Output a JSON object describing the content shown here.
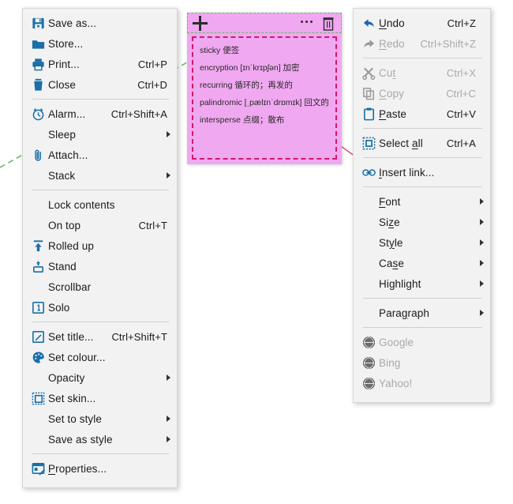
{
  "app": {
    "title": "Sticky note with context menus",
    "note_color": "#f0a8f0",
    "accent_icon_color": "#1a6fa8",
    "disabled_color": "#a9a9a9",
    "green_guide_color": "#66bb66",
    "red_guide_color": "#c0395f"
  },
  "left_menu": {
    "name": "note-context-menu",
    "groups": [
      {
        "items": [
          {
            "icon": "floppy-disk-icon",
            "label": "Save as...",
            "accel": "",
            "arrow": false,
            "disabled": false
          },
          {
            "icon": "folder-icon",
            "label": "Store...",
            "accel": "",
            "arrow": false,
            "disabled": false
          },
          {
            "icon": "printer-icon",
            "label": "Print...",
            "accel": "Ctrl+P",
            "arrow": false,
            "disabled": false
          },
          {
            "icon": "trash-icon",
            "label": "Close",
            "accel": "Ctrl+D",
            "arrow": false,
            "disabled": false
          }
        ]
      },
      {
        "items": [
          {
            "icon": "alarm-clock-icon",
            "label": "Alarm...",
            "accel": "Ctrl+Shift+A",
            "arrow": false,
            "disabled": false
          },
          {
            "icon": "",
            "label": "Sleep",
            "accel": "",
            "arrow": true,
            "disabled": false
          },
          {
            "icon": "paperclip-icon",
            "label": "Attach...",
            "accel": "",
            "arrow": false,
            "disabled": false
          },
          {
            "icon": "",
            "label": "Stack",
            "accel": "",
            "arrow": true,
            "disabled": false
          }
        ]
      },
      {
        "items": [
          {
            "icon": "",
            "label": "Lock contents",
            "accel": "",
            "arrow": false,
            "disabled": false
          },
          {
            "icon": "",
            "label": "On top",
            "accel": "Ctrl+T",
            "arrow": false,
            "disabled": false
          },
          {
            "icon": "roll-up-icon",
            "label": "Rolled up",
            "accel": "",
            "arrow": false,
            "disabled": false
          },
          {
            "icon": "stand-icon",
            "label": "Stand",
            "accel": "",
            "arrow": false,
            "disabled": false
          },
          {
            "icon": "",
            "label": "Scrollbar",
            "accel": "",
            "arrow": false,
            "disabled": false
          },
          {
            "icon": "solo-icon",
            "label": "Solo",
            "accel": "",
            "arrow": false,
            "disabled": false
          }
        ]
      },
      {
        "items": [
          {
            "icon": "pencil-square-icon",
            "label": "Set title...",
            "accel": "Ctrl+Shift+T",
            "arrow": false,
            "disabled": false
          },
          {
            "icon": "palette-icon",
            "label": "Set colour...",
            "accel": "",
            "arrow": false,
            "disabled": false
          },
          {
            "icon": "",
            "label": "Opacity",
            "accel": "",
            "arrow": true,
            "disabled": false
          },
          {
            "icon": "skin-icon",
            "label": "Set skin...",
            "accel": "",
            "arrow": false,
            "disabled": false
          },
          {
            "icon": "",
            "label": "Set to style",
            "accel": "",
            "arrow": true,
            "disabled": false
          },
          {
            "icon": "",
            "label": "Save as style",
            "accel": "",
            "arrow": true,
            "disabled": false
          }
        ]
      },
      {
        "items": [
          {
            "icon": "properties-icon",
            "label": "Properties...",
            "accel": "",
            "arrow": false,
            "disabled": false,
            "underline_first": true
          }
        ]
      }
    ]
  },
  "right_menu": {
    "name": "text-context-menu",
    "groups": [
      {
        "items": [
          {
            "icon": "undo-arrow-icon",
            "label": "Undo",
            "accel": "Ctrl+Z",
            "arrow": false,
            "disabled": false,
            "mnemonic": "U"
          },
          {
            "icon": "redo-arrow-icon",
            "label": "Redo",
            "accel": "Ctrl+Shift+Z",
            "arrow": false,
            "disabled": true,
            "mnemonic": "R"
          }
        ]
      },
      {
        "items": [
          {
            "icon": "scissors-icon",
            "label": "Cut",
            "accel": "Ctrl+X",
            "arrow": false,
            "disabled": true,
            "mnemonic": "t"
          },
          {
            "icon": "copy-icon",
            "label": "Copy",
            "accel": "Ctrl+C",
            "arrow": false,
            "disabled": true,
            "mnemonic": "C"
          },
          {
            "icon": "clipboard-icon",
            "label": "Paste",
            "accel": "Ctrl+V",
            "arrow": false,
            "disabled": false,
            "mnemonic": "P"
          }
        ]
      },
      {
        "items": [
          {
            "icon": "select-all-icon",
            "label": "Select all",
            "accel": "Ctrl+A",
            "arrow": false,
            "disabled": false,
            "mnemonic": "a"
          }
        ]
      },
      {
        "items": [
          {
            "icon": "link-icon",
            "label": "Insert link...",
            "accel": "",
            "arrow": false,
            "disabled": false,
            "mnemonic": "I"
          }
        ]
      },
      {
        "items": [
          {
            "icon": "",
            "label": "Font",
            "accel": "",
            "arrow": true,
            "disabled": false,
            "mnemonic": "F"
          },
          {
            "icon": "",
            "label": "Size",
            "accel": "",
            "arrow": true,
            "disabled": false,
            "mnemonic": "z"
          },
          {
            "icon": "",
            "label": "Style",
            "accel": "",
            "arrow": true,
            "disabled": false,
            "mnemonic": "y"
          },
          {
            "icon": "",
            "label": "Case",
            "accel": "",
            "arrow": true,
            "disabled": false,
            "mnemonic": "s"
          },
          {
            "icon": "",
            "label": "Highlight",
            "accel": "",
            "arrow": true,
            "disabled": false,
            "mnemonic": ""
          }
        ]
      },
      {
        "items": [
          {
            "icon": "",
            "label": "Paragraph",
            "accel": "",
            "arrow": true,
            "disabled": false,
            "mnemonic": "g"
          }
        ]
      },
      {
        "items": [
          {
            "icon": "globe-icon",
            "label": "Google",
            "accel": "",
            "arrow": false,
            "disabled": true
          },
          {
            "icon": "globe-icon",
            "label": "Bing",
            "accel": "",
            "arrow": false,
            "disabled": true
          },
          {
            "icon": "globe-icon",
            "label": "Yahoo!",
            "accel": "",
            "arrow": false,
            "disabled": true
          }
        ]
      }
    ]
  },
  "sticky_note": {
    "toolbar": {
      "add_icon": "plus-icon",
      "more_icon": "ellipsis-icon",
      "delete_icon": "trash-icon"
    },
    "lines": [
      "sticky 便签",
      "encryption [ɪnˈkrɪpʃən] 加密",
      "recurring 循环的；再发的",
      "palindromic [ˌpælɪnˈdrɒmɪk] 回文的",
      "intersperse 点缀；散布"
    ]
  }
}
